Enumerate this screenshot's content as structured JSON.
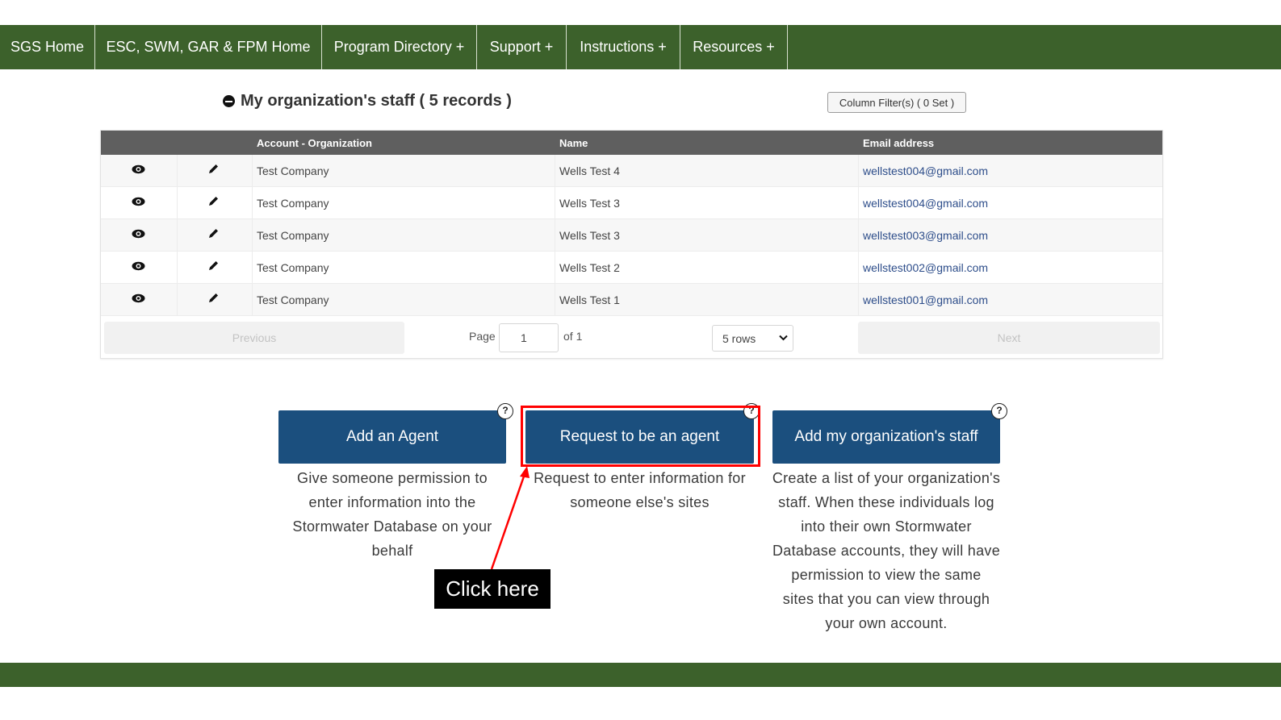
{
  "nav": {
    "items": [
      {
        "label": "SGS Home"
      },
      {
        "label": "ESC, SWM, GAR & FPM Home"
      },
      {
        "label": "Program Directory +"
      },
      {
        "label": "Support +"
      },
      {
        "label": "Instructions +"
      },
      {
        "label": "Resources +"
      }
    ]
  },
  "staff_section": {
    "title": "My organization's staff ( 5 records )",
    "column_filter_label": "Column Filter(s) ( 0 Set )"
  },
  "table": {
    "headers": {
      "account_org": "Account - Organization",
      "name": "Name",
      "email": "Email address"
    },
    "rows": [
      {
        "account_org": "Test Company",
        "name": "Wells Test 4",
        "email": "wellstest004@gmail.com"
      },
      {
        "account_org": "Test Company",
        "name": "Wells Test 3",
        "email": "wellstest004@gmail.com"
      },
      {
        "account_org": "Test Company",
        "name": "Wells Test 3",
        "email": "wellstest003@gmail.com"
      },
      {
        "account_org": "Test Company",
        "name": "Wells Test 2",
        "email": "wellstest002@gmail.com"
      },
      {
        "account_org": "Test Company",
        "name": "Wells Test 1",
        "email": "wellstest001@gmail.com"
      }
    ],
    "row_icons": {
      "view": "eye-icon",
      "edit": "pencil-icon"
    }
  },
  "pagination": {
    "previous_label": "Previous",
    "page_label": "Page",
    "page_value": "1",
    "of_label": "of 1",
    "rows_label": "5 rows",
    "next_label": "Next"
  },
  "actions": {
    "add_agent": {
      "label": "Add an Agent",
      "description_lines": [
        "Give someone permission to",
        "enter information into the",
        "Stormwater Database on your",
        "behalf"
      ]
    },
    "request_agent": {
      "label": "Request to be an agent",
      "description_lines": [
        "Request to enter information for",
        "someone else's sites"
      ]
    },
    "add_staff": {
      "label": "Add my organization's staff",
      "description_lines": [
        "Create a list of your organization's",
        "staff. When these individuals log",
        "into their own Stormwater",
        "Database accounts, they will have",
        "permission to view the same",
        "sites that you can view through",
        "your own account."
      ]
    },
    "help_glyph": "?"
  },
  "annotation": {
    "callout_text": "Click here",
    "highlight_color": "#ff0000"
  },
  "colors": {
    "nav_green": "#3c612b",
    "button_blue": "#1b4f7e",
    "header_gray": "#5f5f5f"
  }
}
